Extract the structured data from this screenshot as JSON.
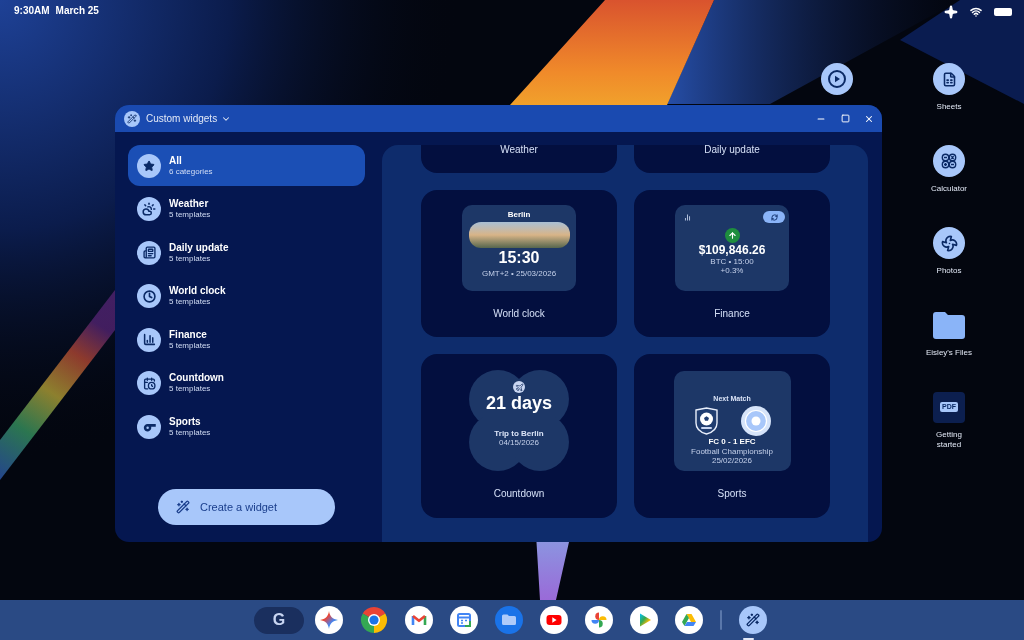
{
  "status_bar": {
    "time": "9:30AM",
    "date": "March 25"
  },
  "desktop": {
    "shortcuts": [
      {
        "kind": "sheets",
        "label": "Sheets"
      },
      {
        "kind": "calculator",
        "label": "Calculator"
      },
      {
        "kind": "photos",
        "label": "Photos"
      },
      {
        "kind": "folder",
        "label": "Eisley's Files"
      },
      {
        "kind": "pdf",
        "badge": "PDF",
        "label": "Getting started"
      }
    ]
  },
  "window": {
    "title": "Custom widgets",
    "categories": [
      {
        "kind": "all",
        "name": "All",
        "count": "6 categories",
        "selected": true
      },
      {
        "kind": "weather",
        "name": "Weather",
        "count": "5 templates",
        "selected": false
      },
      {
        "kind": "daily",
        "name": "Daily update",
        "count": "5 templates",
        "selected": false
      },
      {
        "kind": "clock",
        "name": "World clock",
        "count": "5 templates",
        "selected": false
      },
      {
        "kind": "finance",
        "name": "Finance",
        "count": "5 templates",
        "selected": false
      },
      {
        "kind": "countdown",
        "name": "Countdown",
        "count": "5 templates",
        "selected": false
      },
      {
        "kind": "sports",
        "name": "Sports",
        "count": "5 templates",
        "selected": false
      }
    ],
    "create_button": "Create a widget",
    "widgets": [
      {
        "kind": "partial",
        "label": "Weather"
      },
      {
        "kind": "partial",
        "label": "Daily update"
      },
      {
        "kind": "world_clock",
        "label": "World clock",
        "preview": {
          "city": "Berlin",
          "time": "15:30",
          "detail": "GMT+2 • 25/03/2026"
        }
      },
      {
        "kind": "finance",
        "label": "Finance",
        "preview": {
          "amount": "$109,846.26",
          "detail": "BTC • 15:00",
          "change": "+0.3%"
        }
      },
      {
        "kind": "countdown",
        "label": "Countdown",
        "preview": {
          "days": "21 days",
          "title": "Trip to Berlin",
          "date": "04/15/2026"
        }
      },
      {
        "kind": "sports",
        "label": "Sports",
        "preview": {
          "heading": "Next Match",
          "score": "FC 0 - 1 EFC",
          "league": "Football Championship",
          "date": "25/02/2026"
        }
      }
    ]
  },
  "taskbar": {
    "launcher": "G",
    "apps": [
      {
        "kind": "gemini",
        "open": false
      },
      {
        "kind": "chrome",
        "open": false
      },
      {
        "kind": "gmail",
        "open": false
      },
      {
        "kind": "calendar",
        "open": false
      },
      {
        "kind": "files",
        "open": false
      },
      {
        "kind": "youtube",
        "open": false
      },
      {
        "kind": "photos",
        "open": false
      },
      {
        "kind": "play",
        "open": false
      },
      {
        "kind": "drive",
        "open": false
      },
      {
        "kind": "widgets",
        "open": true
      }
    ]
  }
}
